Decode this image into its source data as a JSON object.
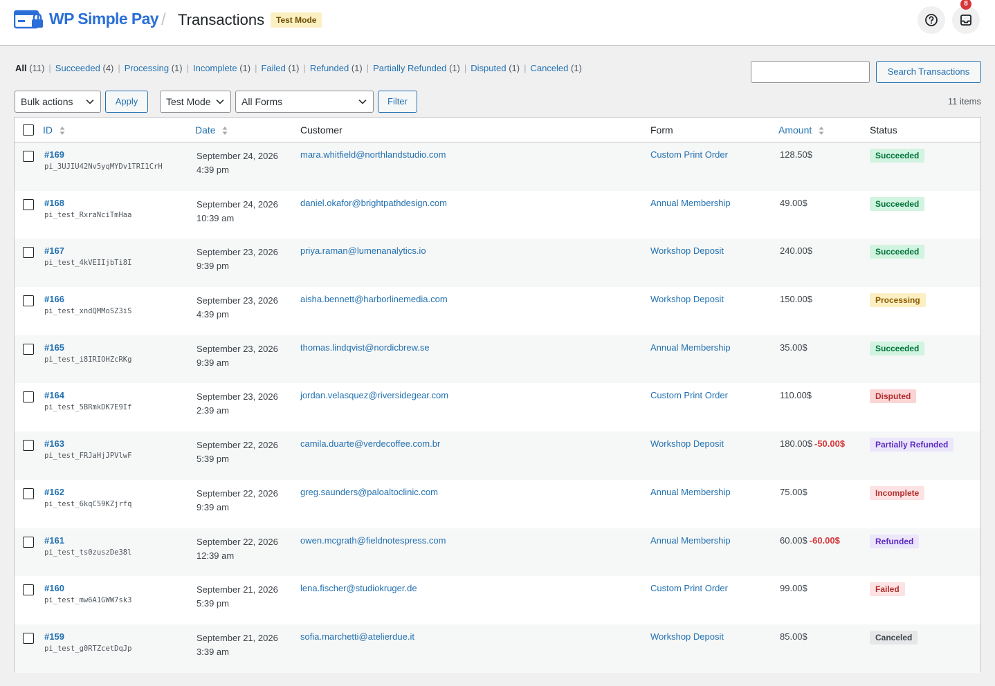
{
  "header": {
    "brand": "WP Simple Pay",
    "separator": "/",
    "title": "Transactions",
    "mode_badge": "Test Mode",
    "notification_count": "8"
  },
  "filters": {
    "statuses": [
      {
        "label": "All",
        "count": "(11)",
        "current": true
      },
      {
        "label": "Succeeded",
        "count": "(4)",
        "current": false
      },
      {
        "label": "Processing",
        "count": "(1)",
        "current": false
      },
      {
        "label": "Incomplete",
        "count": "(1)",
        "current": false
      },
      {
        "label": "Failed",
        "count": "(1)",
        "current": false
      },
      {
        "label": "Refunded",
        "count": "(1)",
        "current": false
      },
      {
        "label": "Partially Refunded",
        "count": "(1)",
        "current": false
      },
      {
        "label": "Disputed",
        "count": "(1)",
        "current": false
      },
      {
        "label": "Canceled",
        "count": "(1)",
        "current": false
      }
    ],
    "search_value": "",
    "search_button": "Search Transactions",
    "bulk_actions": "Bulk actions",
    "apply": "Apply",
    "mode_select": "Test Mode",
    "forms_select": "All Forms",
    "filter_button": "Filter",
    "items_count": "11 items"
  },
  "table": {
    "columns": {
      "id": "ID",
      "date": "Date",
      "customer": "Customer",
      "form": "Form",
      "amount": "Amount",
      "status": "Status"
    },
    "rows": [
      {
        "id": "#169",
        "pi": "pi_3UJIU42Nv5yqMYDv1TRI1CrH",
        "date": "September 24, 2026",
        "time": "4:39 pm",
        "customer": "mara.whitfield@northlandstudio.com",
        "form": "Custom Print Order",
        "amount": "128.50$",
        "refund": "",
        "status": "Succeeded",
        "status_key": "succeeded"
      },
      {
        "id": "#168",
        "pi": "pi_test_RxraNciTmHaa",
        "date": "September 24, 2026",
        "time": "10:39 am",
        "customer": "daniel.okafor@brightpathdesign.com",
        "form": "Annual Membership",
        "amount": "49.00$",
        "refund": "",
        "status": "Succeeded",
        "status_key": "succeeded"
      },
      {
        "id": "#167",
        "pi": "pi_test_4kVEIIjbTi8I",
        "date": "September 23, 2026",
        "time": "9:39 pm",
        "customer": "priya.raman@lumenanalytics.io",
        "form": "Workshop Deposit",
        "amount": "240.00$",
        "refund": "",
        "status": "Succeeded",
        "status_key": "succeeded"
      },
      {
        "id": "#166",
        "pi": "pi_test_xndQMMoSZ3iS",
        "date": "September 23, 2026",
        "time": "4:39 pm",
        "customer": "aisha.bennett@harborlinemedia.com",
        "form": "Workshop Deposit",
        "amount": "150.00$",
        "refund": "",
        "status": "Processing",
        "status_key": "processing"
      },
      {
        "id": "#165",
        "pi": "pi_test_i8IRIOHZcRKg",
        "date": "September 23, 2026",
        "time": "9:39 am",
        "customer": "thomas.lindqvist@nordicbrew.se",
        "form": "Annual Membership",
        "amount": "35.00$",
        "refund": "",
        "status": "Succeeded",
        "status_key": "succeeded"
      },
      {
        "id": "#164",
        "pi": "pi_test_5BRmkDK7E9If",
        "date": "September 23, 2026",
        "time": "2:39 am",
        "customer": "jordan.velasquez@riversidegear.com",
        "form": "Custom Print Order",
        "amount": "110.00$",
        "refund": "",
        "status": "Disputed",
        "status_key": "disputed"
      },
      {
        "id": "#163",
        "pi": "pi_test_FRJaHjJPVlwF",
        "date": "September 22, 2026",
        "time": "5:39 pm",
        "customer": "camila.duarte@verdecoffee.com.br",
        "form": "Workshop Deposit",
        "amount": "180.00$",
        "refund": "-50.00$",
        "status": "Partially Refunded",
        "status_key": "partial"
      },
      {
        "id": "#162",
        "pi": "pi_test_6kqC59KZjrfq",
        "date": "September 22, 2026",
        "time": "9:39 am",
        "customer": "greg.saunders@paloaltoclinic.com",
        "form": "Annual Membership",
        "amount": "75.00$",
        "refund": "",
        "status": "Incomplete",
        "status_key": "incomplete"
      },
      {
        "id": "#161",
        "pi": "pi_test_ts0zuszDe38l",
        "date": "September 22, 2026",
        "time": "12:39 am",
        "customer": "owen.mcgrath@fieldnotespress.com",
        "form": "Annual Membership",
        "amount": "60.00$",
        "refund": "-60.00$",
        "status": "Refunded",
        "status_key": "refunded"
      },
      {
        "id": "#160",
        "pi": "pi_test_mw6A1GWW7sk3",
        "date": "September 21, 2026",
        "time": "5:39 pm",
        "customer": "lena.fischer@studiokruger.de",
        "form": "Custom Print Order",
        "amount": "99.00$",
        "refund": "",
        "status": "Failed",
        "status_key": "failed"
      },
      {
        "id": "#159",
        "pi": "pi_test_g0RTZcetDqJp",
        "date": "September 21, 2026",
        "time": "3:39 am",
        "customer": "sofia.marchetti@atelierdue.it",
        "form": "Workshop Deposit",
        "amount": "85.00$",
        "refund": "",
        "status": "Canceled",
        "status_key": "canceled"
      }
    ]
  },
  "status_colors": {
    "succeeded": {
      "bg": "#d1f4e0",
      "fg": "#00733a"
    },
    "processing": {
      "bg": "#fcf0c3",
      "fg": "#8a5a00"
    },
    "disputed": {
      "bg": "#fbd5d5",
      "fg": "#b32d2e"
    },
    "partial": {
      "bg": "#ece6fb",
      "fg": "#5b2bc0"
    },
    "incomplete": {
      "bg": "#fce2e2",
      "fg": "#b32d2e"
    },
    "refunded": {
      "bg": "#ece6fb",
      "fg": "#5b2bc0"
    },
    "failed": {
      "bg": "#fce2e2",
      "fg": "#b32d2e"
    },
    "canceled": {
      "bg": "#e6e7e8",
      "fg": "#3c434a"
    }
  },
  "colors": {
    "link": "#2271b1",
    "brand": "#2a6fd8",
    "refund": "#d63638"
  },
  "icons": {
    "logo": "wp-simple-pay-logo-icon",
    "help": "help-circle-icon",
    "inbox": "inbox-icon",
    "sort": "sort-arrows-icon",
    "chevron": "chevron-down-icon"
  }
}
